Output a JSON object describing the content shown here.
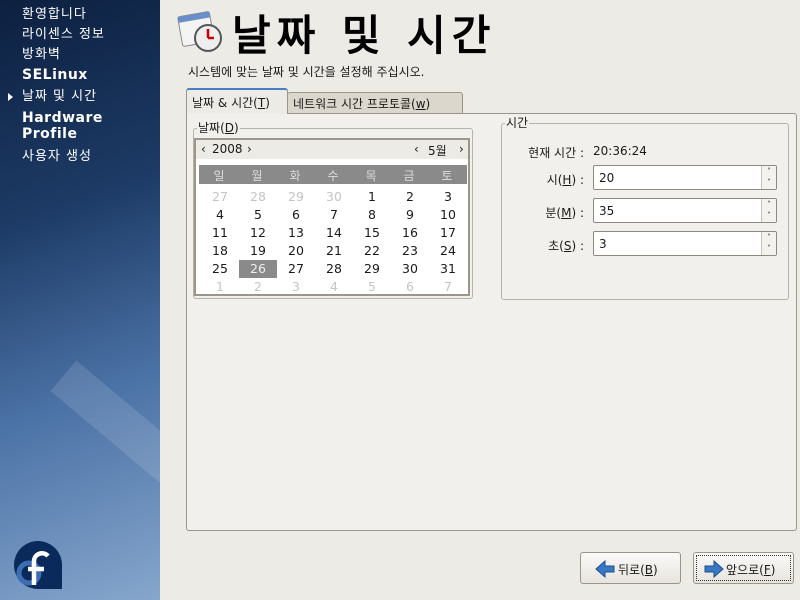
{
  "sidebar": {
    "items": [
      {
        "label": "환영합니다"
      },
      {
        "label": "라이센스 정보"
      },
      {
        "label": "방화벽"
      },
      {
        "label": "SELinux"
      },
      {
        "label": "날짜 및 시간",
        "active": true
      },
      {
        "label": "Hardware Profile"
      },
      {
        "label": "사용자 생성"
      }
    ]
  },
  "header": {
    "title": "날짜 및 시간",
    "subtitle": "시스템에 맞는 날짜 및 시간을 설정해 주십시오.",
    "icon": "calendar-clock-icon"
  },
  "tabs": [
    {
      "label": "날짜 & 시간(",
      "mnemonic": "T",
      "end": ")",
      "active": true
    },
    {
      "label": "네트워크 시간 프로토콜(",
      "mnemonic": "w",
      "end": ")"
    }
  ],
  "date": {
    "label": "날짜(",
    "mnemonic": "D",
    "end": ")",
    "year": "2008",
    "month": "5월",
    "weekdays": [
      "일",
      "월",
      "화",
      "수",
      "목",
      "금",
      "토"
    ],
    "weeks": [
      [
        "27",
        "28",
        "29",
        "30",
        "1",
        "2",
        "3"
      ],
      [
        "4",
        "5",
        "6",
        "7",
        "8",
        "9",
        "10"
      ],
      [
        "11",
        "12",
        "13",
        "14",
        "15",
        "16",
        "17"
      ],
      [
        "18",
        "19",
        "20",
        "21",
        "22",
        "23",
        "24"
      ],
      [
        "25",
        "26",
        "27",
        "28",
        "29",
        "30",
        "31"
      ],
      [
        "1",
        "2",
        "3",
        "4",
        "5",
        "6",
        "7"
      ]
    ],
    "selected": "26"
  },
  "time": {
    "label": "시간",
    "current_label": "현재 시간 :",
    "current_value": "20:36:24",
    "fields": [
      {
        "label": "시(",
        "mnemonic": "H",
        "end": ") :",
        "value": "20"
      },
      {
        "label": "분(",
        "mnemonic": "M",
        "end": ") :",
        "value": "35"
      },
      {
        "label": "초(",
        "mnemonic": "S",
        "end": ") :",
        "value": "3"
      }
    ]
  },
  "buttons": {
    "back": {
      "label": "뒤로(",
      "mnemonic": "B",
      "end": ")"
    },
    "forward": {
      "label": "앞으로(",
      "mnemonic": "F",
      "end": ")"
    }
  },
  "colors": {
    "accent": "#4a7fc6",
    "selected_day": "#8a8a8a",
    "sidebar_top": "#0d2040",
    "sidebar_bottom": "#86a6cc"
  }
}
